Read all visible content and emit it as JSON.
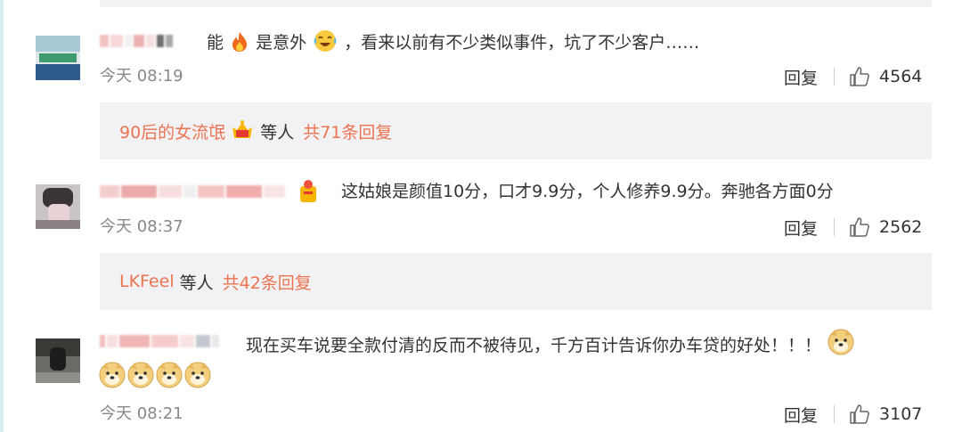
{
  "comments": [
    {
      "text_parts": [
        "能",
        "是意外",
        "，看来以前有不少类似事件，坑了不少客户……"
      ],
      "time": "今天 08:19",
      "reply_label": "回复",
      "likes": "4564",
      "sub": {
        "users": "90后的女流氓",
        "suffix": "等人",
        "count": "共71条回复"
      }
    },
    {
      "text": "这姑娘是颜值10分，口才9.9分，个人修养9.9分。奔驰各方面0分",
      "time": "今天 08:37",
      "reply_label": "回复",
      "likes": "2562",
      "sub": {
        "users": "LKFeel",
        "suffix": "等人",
        "count": "共42条回复"
      }
    },
    {
      "text": "现在买车说要全款付清的反而不被待见，千方百计告诉你办车贷的好处！！！",
      "time": "今天 08:21",
      "reply_label": "回复",
      "likes": "3107"
    }
  ],
  "colors": {
    "accent": "#eb7350",
    "muted": "#888888",
    "sub_bg": "#f2f2f5"
  },
  "icons": [
    "fire-icon",
    "laugh-cry-icon",
    "crown-badge-icon",
    "vip-badge-icon",
    "doge-icon",
    "thumbs-up-icon"
  ]
}
